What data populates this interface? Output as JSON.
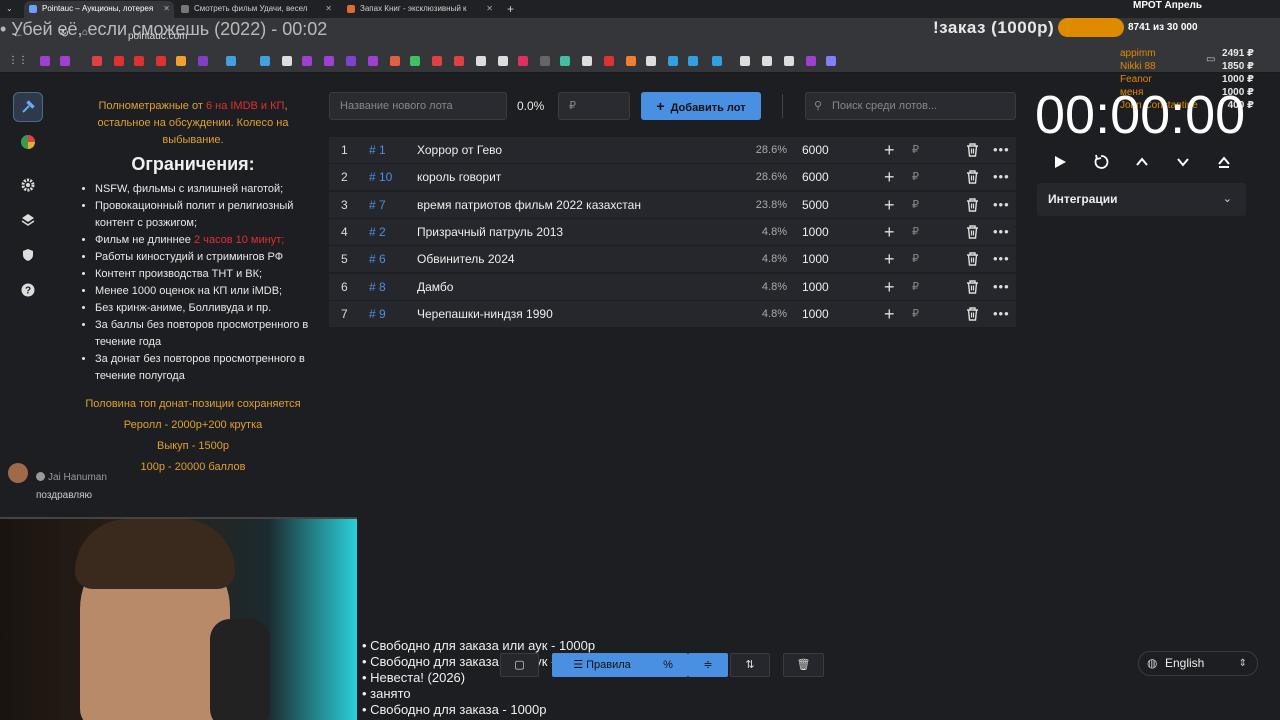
{
  "browser": {
    "tabs": [
      {
        "title": "Pointauc – Аукционы, лотерея"
      },
      {
        "title": "Смотреть фильм Удачи, весел"
      },
      {
        "title": "Запах Книг - эксклюзивный к"
      }
    ],
    "new_tab": "+",
    "url": "pointauc.com"
  },
  "overlay": {
    "stream_title": "• Убей её, если сможешь (2022) - 00:02",
    "order_label": "!заказ (1000р)",
    "mrot_label": "МРОТ Апрель",
    "progress_text": "8741 из 30 000",
    "progress_current": 8741,
    "progress_goal": 30000,
    "donors": [
      {
        "name": "appimm",
        "amount": "2491 ₽"
      },
      {
        "name": "Nikki 88",
        "amount": "1850 ₽"
      },
      {
        "name": "Feanor",
        "amount": "1000 ₽"
      },
      {
        "name": "меня",
        "amount": "1000 ₽"
      },
      {
        "name": "John Constantine",
        "amount": "400 ₽"
      }
    ]
  },
  "rules": {
    "intro_a": "Полнометражные от ",
    "intro_b": "6 на IMDB и КП",
    "intro_c": ", остальное на обсуждении. Колесо на выбывание.",
    "heading": "Ограничения:",
    "items": [
      "NSFW, фильмы с излишней наготой;",
      "Провокационный полит и религиозный контент с розжигом;",
      "Фильм не длиннее ",
      "Работы киностудий и стримингов РФ",
      "Контент производства ТНТ и ВК;",
      "Менее 1000 оценок на КП или iMDB;",
      "Без кринж-аниме, Болливуда и пр.",
      "За баллы без повторов просмотренного в течение года",
      "За донат без повторов просмотренного в течение полугода"
    ],
    "length_limit": "2 часов 10 минут;",
    "footer": [
      "Половина топ донат-позиции сохраняется",
      "Реролл - 2000р+200 крутка",
      "Выкуп - 1500р",
      "100р - 20000 баллов"
    ]
  },
  "lots_form": {
    "name_placeholder": "Название нового лота",
    "total_pct": "0.0%",
    "amount_placeholder": "₽",
    "add_label": "Добавить лот",
    "search_placeholder": "Поиск среди лотов..."
  },
  "lots": [
    {
      "n": "1",
      "id": "# 1",
      "name": "Хоррор от Гево",
      "pct": "28.6%",
      "amount": "6000"
    },
    {
      "n": "2",
      "id": "# 10",
      "name": "король говорит",
      "pct": "28.6%",
      "amount": "6000"
    },
    {
      "n": "3",
      "id": "# 7",
      "name": "время патриотов фильм 2022 казахстан",
      "pct": "23.8%",
      "amount": "5000"
    },
    {
      "n": "4",
      "id": "# 2",
      "name": "Призрачный патруль 2013",
      "pct": "4.8%",
      "amount": "1000"
    },
    {
      "n": "5",
      "id": "# 6",
      "name": "Обвинитель 2024",
      "pct": "4.8%",
      "amount": "1000"
    },
    {
      "n": "6",
      "id": "# 8",
      "name": "Дамбо",
      "pct": "4.8%",
      "amount": "1000"
    },
    {
      "n": "7",
      "id": "# 9",
      "name": "Черепашки-ниндзя 1990",
      "pct": "4.8%",
      "amount": "1000"
    }
  ],
  "lot_row_labels": {
    "plus": "+",
    "rub": "₽",
    "more": "•••"
  },
  "timer": {
    "value": "00:00:00"
  },
  "integrations_label": "Интеграции",
  "chat": {
    "user": "Jai Hanuman",
    "message": "поздравляю"
  },
  "queue": [
    "• Свободно для заказа или аук - 1000р",
    "• Свободно для заказа или аук - 1000р",
    "• Невеста! (2026)",
    "• занято",
    "• Свободно для заказа - 1000р"
  ],
  "toolbar": {
    "rules_label": "Правила",
    "pct_label": "%"
  },
  "language": "English"
}
